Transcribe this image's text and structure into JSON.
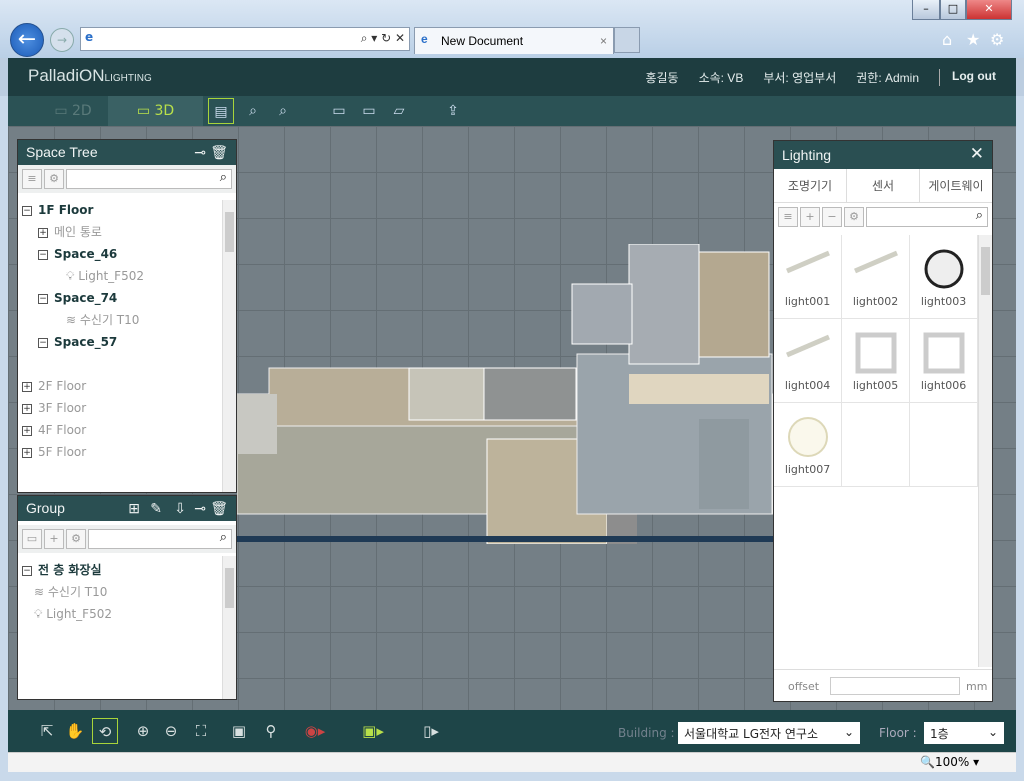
{
  "browser": {
    "tab_title": "New Document",
    "address": "",
    "zoom": "100%"
  },
  "app": {
    "logo_main": "PalladiON",
    "logo_sub": "LIGHTING",
    "user_name": "홍길동",
    "affiliation": "소속: VB",
    "department": "부서: 영업부서",
    "role": "권한: Admin",
    "logout": "Log out",
    "view_2d": "2D",
    "view_3d": "3D",
    "accent": "#a8d43a"
  },
  "space_tree": {
    "title": "Space Tree",
    "items": [
      {
        "label": "1F Floor",
        "level": 0,
        "toggle": "−",
        "style": "bold"
      },
      {
        "label": "메인 통로",
        "level": 1,
        "toggle": "+",
        "style": "gray"
      },
      {
        "label": "Space_46",
        "level": 1,
        "toggle": "−",
        "style": "bold"
      },
      {
        "label": "Light_F502",
        "level": 2,
        "icon": "bulb",
        "style": "gray"
      },
      {
        "label": "Space_74",
        "level": 1,
        "toggle": "−",
        "style": "bold"
      },
      {
        "label": "수신기 T10",
        "level": 2,
        "icon": "wifi",
        "style": "gray"
      },
      {
        "label": "Space_57",
        "level": 1,
        "toggle": "−",
        "style": "bold"
      },
      {
        "label": "",
        "level": 0
      },
      {
        "label": "2F Floor",
        "level": 0,
        "toggle": "+",
        "style": "gray"
      },
      {
        "label": "3F Floor",
        "level": 0,
        "toggle": "+",
        "style": "gray"
      },
      {
        "label": "4F Floor",
        "level": 0,
        "toggle": "+",
        "style": "gray"
      },
      {
        "label": "5F Floor",
        "level": 0,
        "toggle": "+",
        "style": "gray"
      }
    ]
  },
  "group": {
    "title": "Group",
    "items": [
      {
        "label": "전 층 화장실",
        "toggle": "−",
        "style": "bold"
      },
      {
        "label": "수신기 T10",
        "icon": "wifi",
        "style": "gray"
      },
      {
        "label": "Light_F502",
        "icon": "bulb",
        "style": "gray"
      }
    ]
  },
  "lighting": {
    "title": "Lighting",
    "tabs": [
      "조명기기",
      "센서",
      "게이트웨이"
    ],
    "items": [
      {
        "name": "light001",
        "shape": "bar"
      },
      {
        "name": "light002",
        "shape": "bar"
      },
      {
        "name": "light003",
        "shape": "ring"
      },
      {
        "name": "light004",
        "shape": "bar"
      },
      {
        "name": "light005",
        "shape": "square"
      },
      {
        "name": "light006",
        "shape": "square"
      },
      {
        "name": "light007",
        "shape": "disc"
      }
    ],
    "offset_label": "offset",
    "offset_value": "",
    "unit": "mm"
  },
  "bottom": {
    "building_label": "Building :",
    "building_value": "서울대학교 LG전자 연구소",
    "floor_label": "Floor :",
    "floor_value": "1층"
  }
}
